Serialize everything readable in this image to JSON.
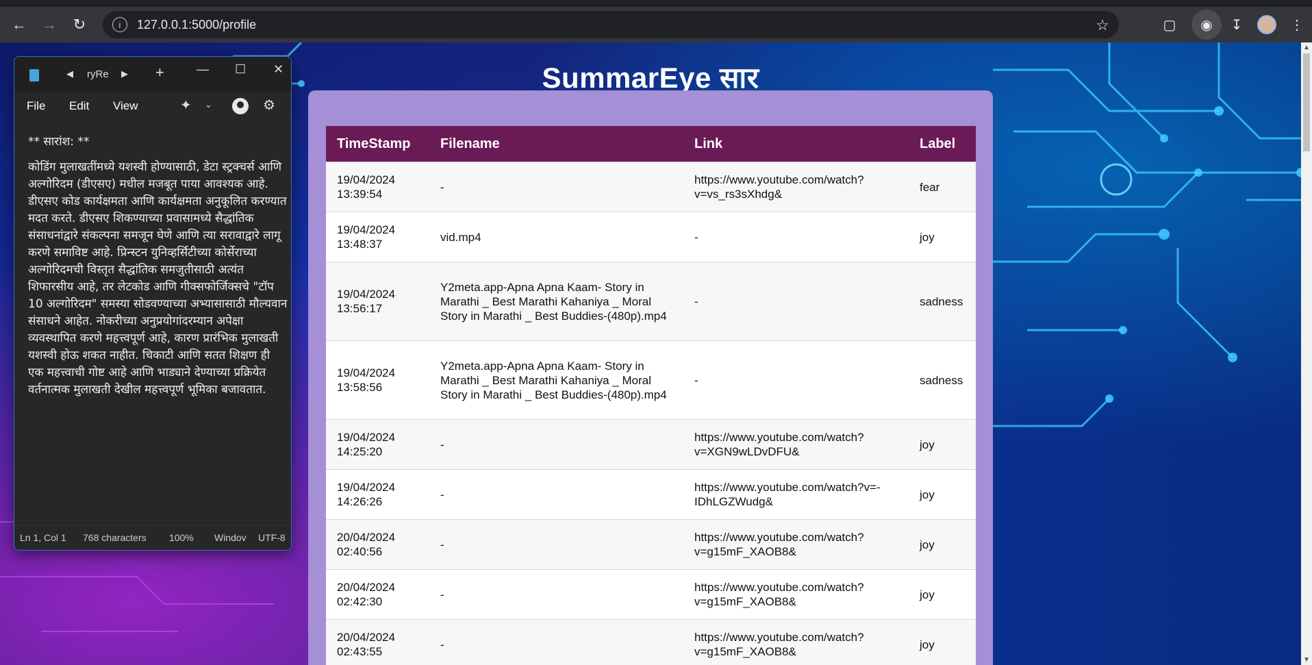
{
  "browser": {
    "url": "127.0.0.1:5000/profile"
  },
  "page": {
    "title": "SummarEye सार"
  },
  "table": {
    "headers": [
      "TimeStamp",
      "Filename",
      "Link",
      "Label"
    ],
    "rows": [
      {
        "timestamp": "19/04/2024 13:39:54",
        "filename": "-",
        "link": "https://www.youtube.com/watch?v=vs_rs3sXhdg&",
        "label": "fear"
      },
      {
        "timestamp": "19/04/2024 13:48:37",
        "filename": "vid.mp4",
        "link": "-",
        "label": "joy"
      },
      {
        "timestamp": "19/04/2024 13:56:17",
        "filename": "Y2meta.app-Apna Apna Kaam- Story in Marathi _ Best Marathi Kahaniya _ Moral Story in Marathi _ Best Buddies-(480p).mp4",
        "link": "-",
        "label": "sadness"
      },
      {
        "timestamp": "19/04/2024 13:58:56",
        "filename": "Y2meta.app-Apna Apna Kaam- Story in Marathi _ Best Marathi Kahaniya _ Moral Story in Marathi _ Best Buddies-(480p).mp4",
        "link": "-",
        "label": "sadness"
      },
      {
        "timestamp": "19/04/2024 14:25:20",
        "filename": "-",
        "link": "https://www.youtube.com/watch?v=XGN9wLDvDFU&",
        "label": "joy"
      },
      {
        "timestamp": "19/04/2024 14:26:26",
        "filename": "-",
        "link": "https://www.youtube.com/watch?v=-IDhLGZWudg&",
        "label": "joy"
      },
      {
        "timestamp": "20/04/2024 02:40:56",
        "filename": "-",
        "link": "https://www.youtube.com/watch?v=g15mF_XAOB8&",
        "label": "joy"
      },
      {
        "timestamp": "20/04/2024 02:42:30",
        "filename": "-",
        "link": "https://www.youtube.com/watch?v=g15mF_XAOB8&",
        "label": "joy"
      },
      {
        "timestamp": "20/04/2024 02:43:55",
        "filename": "-",
        "link": "https://www.youtube.com/watch?v=g15mF_XAOB8&",
        "label": "joy"
      }
    ]
  },
  "notepad": {
    "tab_name": "ryRe",
    "menu": {
      "file": "File",
      "edit": "Edit",
      "view": "View"
    },
    "heading": "** सारांश: **",
    "body": "कोडिंग मुलाखतींमध्ये यशस्वी होण्यासाठी, डेटा स्ट्रक्चर्स आणि अल्गोरिदम (डीएसए) मधील मजबूत पाया आवश्यक आहे. डीएसए कोड कार्यक्षमता आणि कार्यक्षमता अनुकूलित करण्यात मदत करते. डीएसए शिकण्याच्या प्रवासामध्ये सैद्धांतिक संसाधनांद्वारे संकल्पना समजून घेणे आणि त्या सरावाद्वारे लागू करणे समाविष्ट आहे. प्रिन्स्टन युनिव्हर्सिटीच्या कोर्सेराच्या अल्गोरिदमची विस्तृत सैद्धांतिक समजुतीसाठी अत्यंत शिफारसीय आहे, तर लेटकोड आणि गीक्सफोर्जिक्सचे \"टॉप 10 अल्गोरिदम\" समस्या सोडवण्याच्या अभ्यासासाठी मौल्यवान संसाधने आहेत. नोकरीच्या अनुप्रयोगांदरम्यान अपेक्षा व्यवस्थापित करणे महत्त्वपूर्ण आहे, कारण प्रारंभिक मुलाखती यशस्वी होऊ शकत नाहीत. चिकाटी आणि सतत शिक्षण ही एक महत्त्वाची गोष्ट आहे आणि भाड्याने देण्याच्या प्रक्रियेत वर्तनात्मक मुलाखती देखील महत्त्वपूर्ण भूमिका बजावतात.",
    "status": {
      "position": "Ln 1, Col 1",
      "characters": "768 characters",
      "zoom": "100%",
      "line_ending": "Windov",
      "encoding": "UTF-8"
    }
  }
}
